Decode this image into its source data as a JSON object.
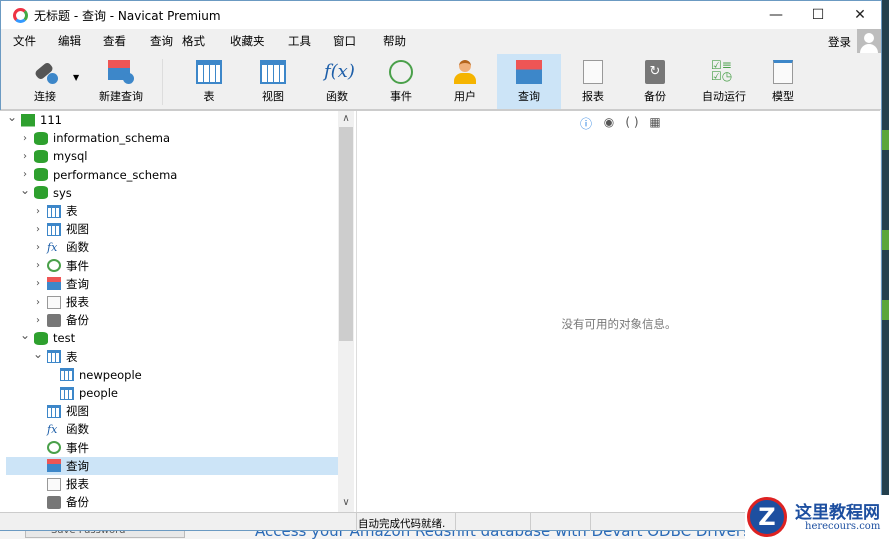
{
  "window": {
    "title": "无标题 - 查询 - Navicat Premium",
    "minimize": "—",
    "maximize": "☐",
    "close": "✕"
  },
  "menu": [
    "文件",
    "编辑",
    "查看",
    "查询",
    "格式",
    "收藏夹",
    "工具",
    "窗口",
    "帮助"
  ],
  "login": "登录",
  "toolbar": [
    {
      "label": "连接",
      "icon": "connection-icon"
    },
    {
      "label": "新建查询",
      "icon": "new-query-icon"
    },
    {
      "label": "表",
      "icon": "table-icon"
    },
    {
      "label": "视图",
      "icon": "view-icon"
    },
    {
      "label": "函数",
      "icon": "function-icon"
    },
    {
      "label": "事件",
      "icon": "event-icon"
    },
    {
      "label": "用户",
      "icon": "user-icon"
    },
    {
      "label": "查询",
      "icon": "query-icon",
      "active": true
    },
    {
      "label": "报表",
      "icon": "report-icon"
    },
    {
      "label": "备份",
      "icon": "backup-icon"
    },
    {
      "label": "自动运行",
      "icon": "automation-icon"
    },
    {
      "label": "模型",
      "icon": "model-icon"
    }
  ],
  "tree": [
    {
      "label": "111",
      "level": 0,
      "arrow": "v",
      "icon": "conn"
    },
    {
      "label": "information_schema",
      "level": 1,
      "arrow": ">",
      "icon": "db"
    },
    {
      "label": "mysql",
      "level": 1,
      "arrow": ">",
      "icon": "db"
    },
    {
      "label": "performance_schema",
      "level": 1,
      "arrow": ">",
      "icon": "db"
    },
    {
      "label": "sys",
      "level": 1,
      "arrow": "v",
      "icon": "db"
    },
    {
      "label": "表",
      "level": 2,
      "arrow": ">",
      "icon": "tbl"
    },
    {
      "label": "视图",
      "level": 2,
      "arrow": ">",
      "icon": "tbl"
    },
    {
      "label": "函数",
      "level": 2,
      "arrow": ">",
      "icon": "fx"
    },
    {
      "label": "事件",
      "level": 2,
      "arrow": ">",
      "icon": "clk"
    },
    {
      "label": "查询",
      "level": 2,
      "arrow": ">",
      "icon": "qry"
    },
    {
      "label": "报表",
      "level": 2,
      "arrow": ">",
      "icon": "rpt"
    },
    {
      "label": "备份",
      "level": 2,
      "arrow": ">",
      "icon": "bak"
    },
    {
      "label": "test",
      "level": 1,
      "arrow": "v",
      "icon": "db"
    },
    {
      "label": "表",
      "level": 2,
      "arrow": "v",
      "icon": "tbl"
    },
    {
      "label": "newpeople",
      "level": 3,
      "arrow": "",
      "icon": "tbl"
    },
    {
      "label": "people",
      "level": 3,
      "arrow": "",
      "icon": "tbl"
    },
    {
      "label": "视图",
      "level": 2,
      "arrow": "",
      "icon": "tbl"
    },
    {
      "label": "函数",
      "level": 2,
      "arrow": "",
      "icon": "fx"
    },
    {
      "label": "事件",
      "level": 2,
      "arrow": "",
      "icon": "clk"
    },
    {
      "label": "查询",
      "level": 2,
      "arrow": "",
      "icon": "qry",
      "selected": true
    },
    {
      "label": "报表",
      "level": 2,
      "arrow": "",
      "icon": "rpt"
    },
    {
      "label": "备份",
      "level": 2,
      "arrow": "",
      "icon": "bak"
    }
  ],
  "right_tools": [
    "ⓘ",
    "◉",
    "( )",
    "▦"
  ],
  "empty_message": "没有可用的对象信息。",
  "status": "自动完成代码就绪.",
  "background": {
    "save_password": "Save Password",
    "ad": "Access your Amazon Redshift database with Devart ODBC Driver!"
  },
  "watermark": {
    "title": "这里教程网",
    "url": "herecours.com"
  }
}
